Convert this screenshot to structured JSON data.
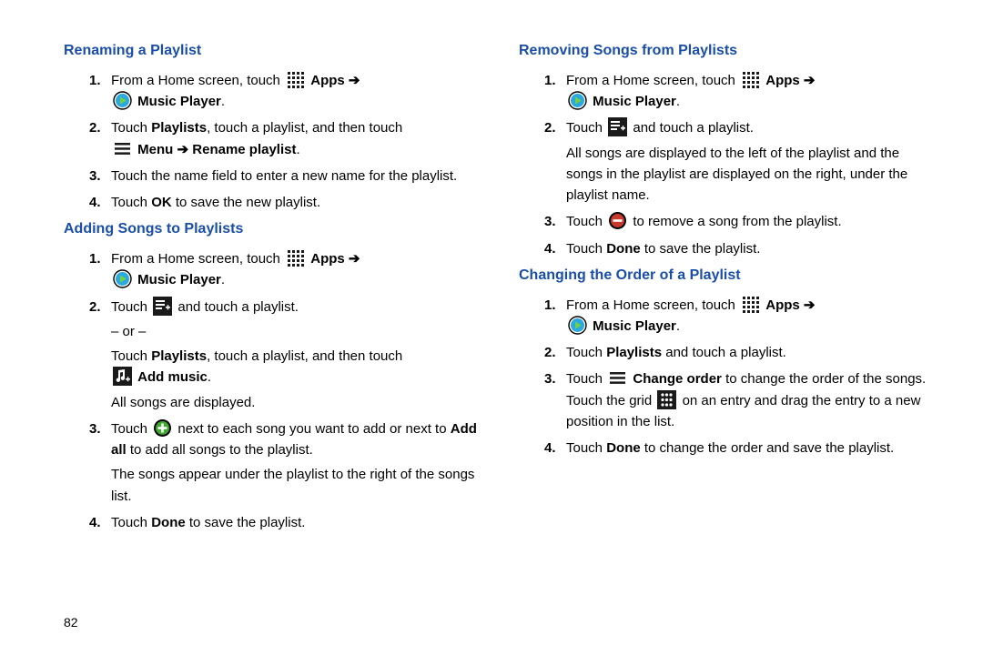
{
  "page_number": "82",
  "labels": {
    "apps": "Apps",
    "arrow": "➔",
    "music_player": "Music Player",
    "menu": "Menu",
    "rename_playlist": "Rename playlist",
    "add_music": "Add music",
    "change_order": "Change order",
    "ok": "OK",
    "done": "Done",
    "playlists": "Playlists",
    "add_all": "Add all"
  },
  "left": {
    "sec1": {
      "title": "Renaming a Playlist",
      "s1a": "From a Home screen, touch",
      "s2a": "Touch ",
      "s2b": ", touch a playlist, and then touch",
      "s3": "Touch the name field to enter a new name for the playlist.",
      "s4a": "Touch ",
      "s4b": " to save the new playlist."
    },
    "sec2": {
      "title": "Adding Songs to Playlists",
      "s1a": "From a Home screen, touch",
      "s2a": "Touch ",
      "s2b": " and touch a playlist.",
      "or": "– or –",
      "s2c": "Touch ",
      "s2d": ", touch a playlist, and then touch",
      "s2e": "All songs are displayed.",
      "s3a": "Touch ",
      "s3b": " next to each song you want to add or next to ",
      "s3c": " to add all songs to the playlist.",
      "s3d": "The songs appear under the playlist to the right of the songs list.",
      "s4a": "Touch ",
      "s4b": " to save the playlist."
    }
  },
  "right": {
    "sec1": {
      "title": "Removing Songs from Playlists",
      "s1a": "From a Home screen, touch",
      "s2a": "Touch ",
      "s2b": " and touch a playlist.",
      "s2c": "All songs are displayed to the left of the playlist and the songs in the playlist are displayed on the right, under the playlist name.",
      "s3a": "Touch ",
      "s3b": " to remove a song from the playlist.",
      "s4a": "Touch ",
      "s4b": " to save the playlist."
    },
    "sec2": {
      "title": "Changing the Order of a Playlist",
      "s1a": "From a Home screen, touch",
      "s2a": "Touch ",
      "s2b": " and touch a playlist.",
      "s3a": "Touch ",
      "s3b": " to change the order of the songs. Touch the grid ",
      "s3c": " on an entry and drag the entry to a new position in the list.",
      "s4a": "Touch ",
      "s4b": " to change the order and save the playlist."
    }
  }
}
